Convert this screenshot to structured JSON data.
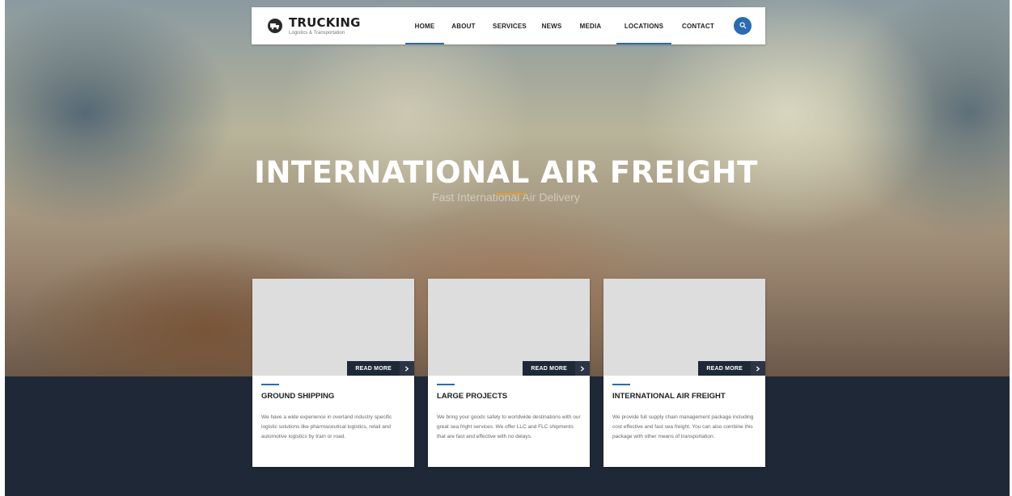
{
  "brand": {
    "name": "TRUCKING",
    "tagline": "Logistics & Transportation"
  },
  "nav": {
    "items": [
      {
        "label": "HOME"
      },
      {
        "label": "ABOUT"
      },
      {
        "label": "SERVICES"
      },
      {
        "label": "NEWS"
      },
      {
        "label": "MEDIA"
      },
      {
        "label": "LOCATIONS"
      },
      {
        "label": "CONTACT"
      }
    ],
    "active": "HOME",
    "search_icon": "search-icon"
  },
  "hero": {
    "title": "INTERNATIONAL AIR FREIGHT",
    "subtitle": "Fast International Air Delivery"
  },
  "cards": [
    {
      "title": "GROUND SHIPPING",
      "button": "READ MORE",
      "text": "We have a wide experience in overland industry specific logistic solutions like pharmaceutical logistics, retail and automotive logistics by train or road."
    },
    {
      "title": "LARGE PROJECTS",
      "button": "READ MORE",
      "text": "We bring your goods safely to worldwide destinations with our great sea fright services. We offer LLC and FLC shipments that are fast and effective with no delays."
    },
    {
      "title": "INTERNATIONAL AIR FREIGHT",
      "button": "READ MORE",
      "text": "We provide full supply chain management package including cost effective and fast sea freight. You can also combine this package with other means of transportation."
    }
  ],
  "colors": {
    "accent": "#2b6cb0",
    "dark": "#1f2837",
    "highlight": "#e0a030"
  }
}
